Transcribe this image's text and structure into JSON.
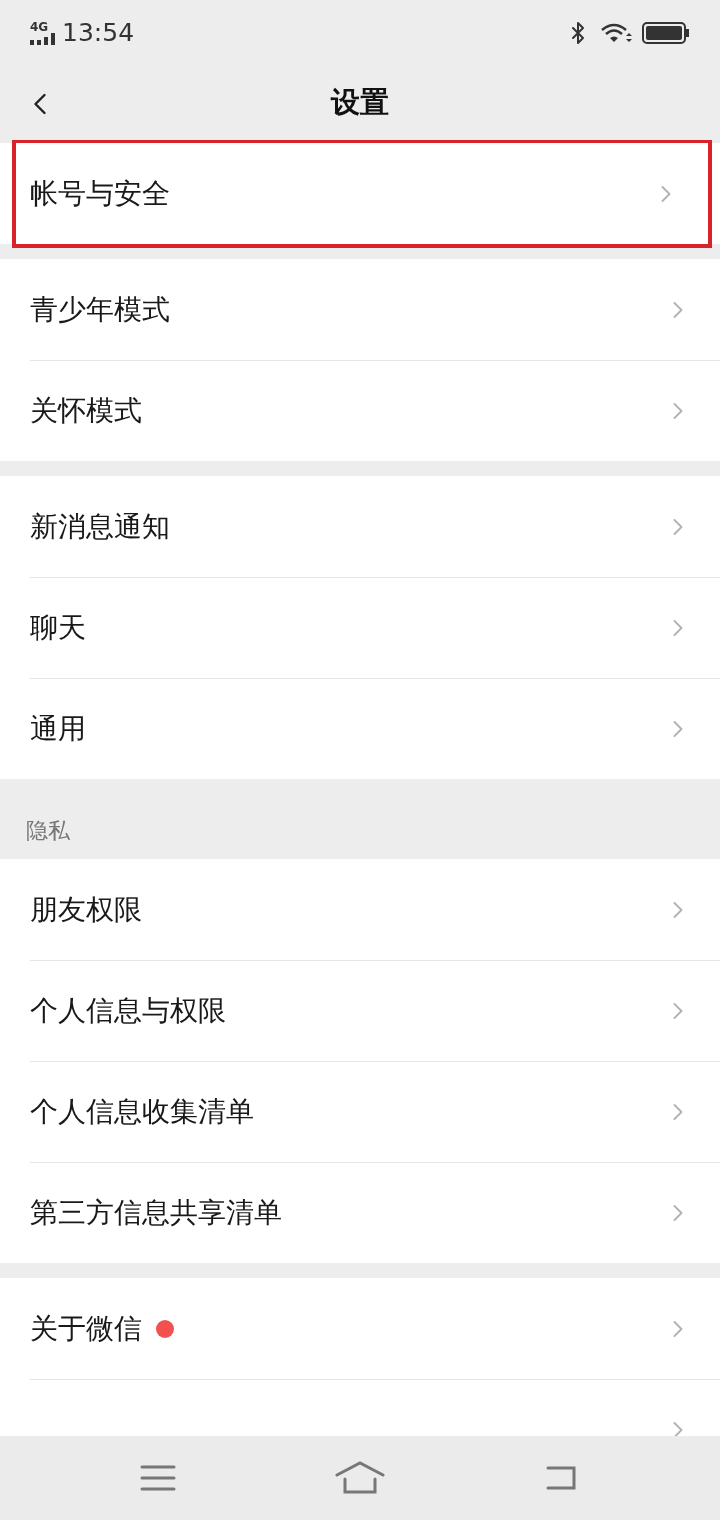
{
  "status_bar": {
    "network": "4G",
    "time": "13:54"
  },
  "header": {
    "title": "设置"
  },
  "groups": [
    {
      "items": [
        {
          "label": "帐号与安全",
          "highlighted": true,
          "dot": false
        }
      ]
    },
    {
      "items": [
        {
          "label": "青少年模式",
          "highlighted": false,
          "dot": false
        },
        {
          "label": "关怀模式",
          "highlighted": false,
          "dot": false
        }
      ]
    },
    {
      "items": [
        {
          "label": "新消息通知",
          "highlighted": false,
          "dot": false
        },
        {
          "label": "聊天",
          "highlighted": false,
          "dot": false
        },
        {
          "label": "通用",
          "highlighted": false,
          "dot": false
        }
      ]
    },
    {
      "title": "隐私",
      "items": [
        {
          "label": "朋友权限",
          "highlighted": false,
          "dot": false
        },
        {
          "label": "个人信息与权限",
          "highlighted": false,
          "dot": false
        },
        {
          "label": "个人信息收集清单",
          "highlighted": false,
          "dot": false
        },
        {
          "label": "第三方信息共享清单",
          "highlighted": false,
          "dot": false
        }
      ]
    },
    {
      "items": [
        {
          "label": "关于微信",
          "highlighted": false,
          "dot": true
        },
        {
          "highlighted": false,
          "dot": false
        }
      ]
    }
  ]
}
